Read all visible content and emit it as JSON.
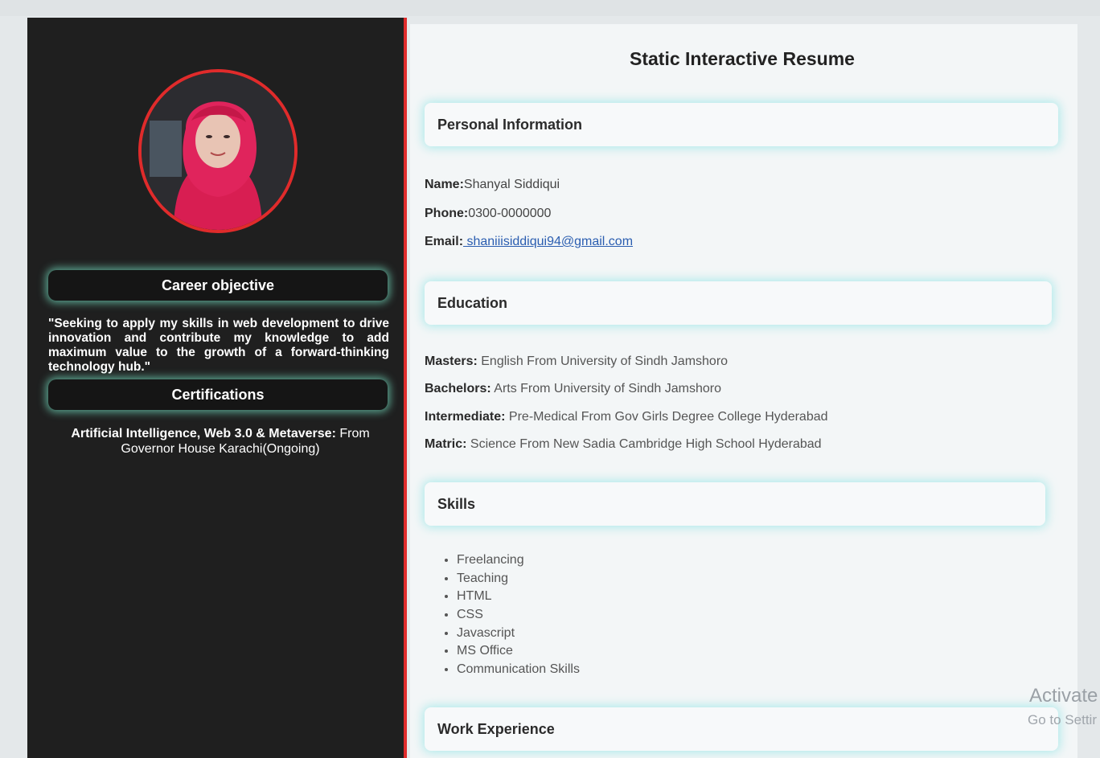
{
  "sidebar": {
    "career_objective": {
      "heading": "Career objective",
      "text": "\"Seeking to apply my skills in web development to drive innovation and contribute my knowledge to add maximum value to the growth of a forward-thinking technology hub.\""
    },
    "certifications": {
      "heading": "Certifications",
      "item_title": "Artificial Intelligence, Web 3.0 & Metaverse:",
      "item_detail": " From Governor House Karachi(Ongoing)"
    }
  },
  "main": {
    "title": "Static Interactive Resume",
    "personal": {
      "heading": "Personal Information",
      "name_label": "Name:",
      "name_value": "Shanyal Siddiqui",
      "phone_label": "Phone:",
      "phone_value": "0300-0000000",
      "email_label": "Email:",
      "email_value": " shaniiisiddiqui94@gmail.com"
    },
    "education": {
      "heading": "Education",
      "items": [
        {
          "label": "Masters:",
          "value": " English From University of Sindh Jamshoro"
        },
        {
          "label": "Bachelors:",
          "value": " Arts From University of Sindh Jamshoro"
        },
        {
          "label": "Intermediate:",
          "value": " Pre-Medical From Gov Girls Degree College Hyderabad"
        },
        {
          "label": "Matric:",
          "value": " Science From New Sadia Cambridge High School Hyderabad"
        }
      ]
    },
    "skills": {
      "heading": "Skills",
      "items": [
        "Freelancing",
        "Teaching",
        "HTML",
        "CSS",
        "Javascript",
        "MS Office",
        "Communication Skills"
      ]
    },
    "work": {
      "heading": "Work Experience"
    }
  },
  "watermark": {
    "line1": "Activate",
    "line2": "Go to Settir"
  },
  "colors": {
    "accent_red": "#e02b2b",
    "glow": "#78e6c8",
    "sidebar_bg": "#1f1f1f"
  }
}
